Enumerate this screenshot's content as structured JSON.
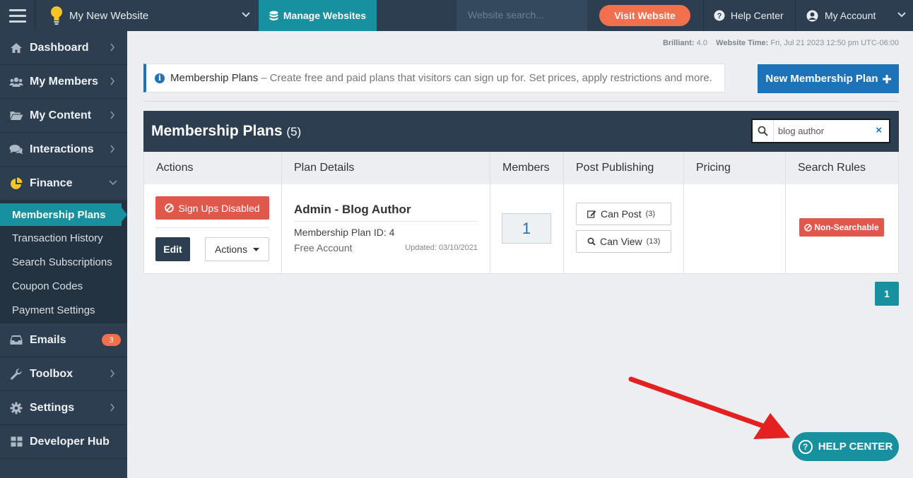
{
  "topbar": {
    "site_name": "My New Website",
    "manage_label": "Manage Websites",
    "search_placeholder": "Website search...",
    "visit_label": "Visit Website",
    "help_label": "Help Center",
    "account_label": "My Account"
  },
  "sidebar": {
    "items": [
      {
        "label": "Dashboard",
        "icon": "home-icon"
      },
      {
        "label": "My Members",
        "icon": "users-icon"
      },
      {
        "label": "My Content",
        "icon": "folder-icon"
      },
      {
        "label": "Interactions",
        "icon": "comments-icon"
      },
      {
        "label": "Finance",
        "icon": "pie-chart-icon"
      }
    ],
    "finance_sub": [
      "Membership Plans",
      "Transaction History",
      "Search Subscriptions",
      "Coupon Codes",
      "Payment Settings"
    ],
    "items_after": [
      {
        "label": "Emails",
        "icon": "inbox-icon",
        "badge": "3"
      },
      {
        "label": "Toolbox",
        "icon": "wrench-icon"
      },
      {
        "label": "Settings",
        "icon": "gear-icon"
      },
      {
        "label": "Developer Hub",
        "icon": "grid-icon"
      }
    ]
  },
  "status": {
    "version_label": "Brilliant:",
    "version": "4.0",
    "time_label": "Website Time:",
    "time": "Fri, Jul 21 2023 12:50 pm UTC-06:00"
  },
  "info": {
    "title": "Membership Plans",
    "text": "– Create free and paid plans that visitors can sign up for. Set prices, apply restrictions and more."
  },
  "new_plan_label": "New Membership Plan",
  "panel": {
    "title": "Membership Plans",
    "count": "(5)",
    "search_value": "blog author"
  },
  "table": {
    "headers": [
      "Actions",
      "Plan Details",
      "Members",
      "Post Publishing",
      "Pricing",
      "Search Rules"
    ],
    "row": {
      "signup_label": "Sign Ups Disabled",
      "edit_label": "Edit",
      "actions_label": "Actions",
      "plan_name": "Admin - Blog Author",
      "plan_id": "Membership Plan ID: 4",
      "plan_type": "Free Account",
      "updated": "Updated: 03/10/2021",
      "members": "1",
      "can_post_label": "Can Post",
      "can_post_count": "(3)",
      "can_view_label": "Can View",
      "can_view_count": "(13)",
      "search_rule": "Non-Searchable"
    }
  },
  "pager_page": "1",
  "help_float_label": "HELP CENTER",
  "colors": {
    "accent": "#17909f",
    "navy": "#2c3e50",
    "blue": "#1c73b8",
    "danger": "#e0584b",
    "orange": "#f3704f",
    "arrow": "#e32121"
  }
}
